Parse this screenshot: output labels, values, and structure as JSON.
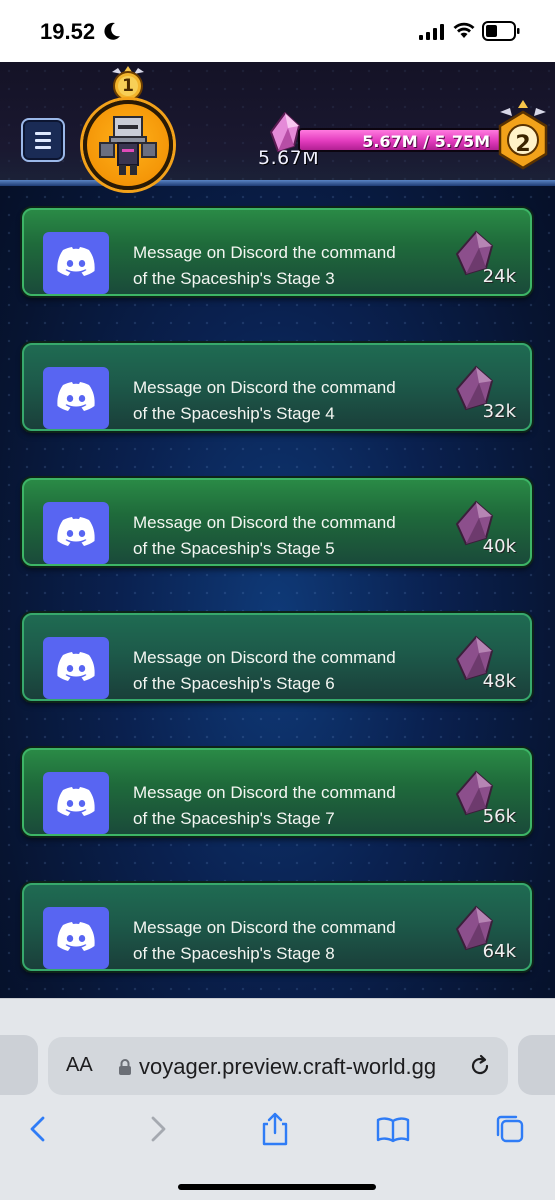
{
  "status_bar": {
    "time": "19.52"
  },
  "header": {
    "player_rank": "1",
    "balance": "5.67M",
    "progress_text": "5.67M / 5.75M",
    "progress_fraction": 0.986,
    "level": "2"
  },
  "tasks": [
    {
      "line1": "Message on Discord the command",
      "line2": "of the Spaceship's Stage 3",
      "reward": "24k"
    },
    {
      "line1": "Message on Discord the command",
      "line2": "of the Spaceship's Stage 4",
      "reward": "32k"
    },
    {
      "line1": "Message on Discord the command",
      "line2": "of the Spaceship's Stage 5",
      "reward": "40k"
    },
    {
      "line1": "Message on Discord the command",
      "line2": "of the Spaceship's Stage 6",
      "reward": "48k"
    },
    {
      "line1": "Message on Discord the command",
      "line2": "of the Spaceship's Stage 7",
      "reward": "56k"
    },
    {
      "line1": "Message on Discord the command",
      "line2": "of the Spaceship's Stage 8",
      "reward": "64k"
    }
  ],
  "browser": {
    "text_size_label": "AA",
    "url": "voyager.preview.craft-world.gg"
  },
  "icons": {
    "task_icon": "discord-icon",
    "reward_icon": "gem-icon",
    "menu": "hamburger-icon",
    "privacy": "shield-check-icon"
  },
  "colors": {
    "discord": "#5865f2",
    "progress": "#e23bbd",
    "card_green": "#2a8a46"
  }
}
